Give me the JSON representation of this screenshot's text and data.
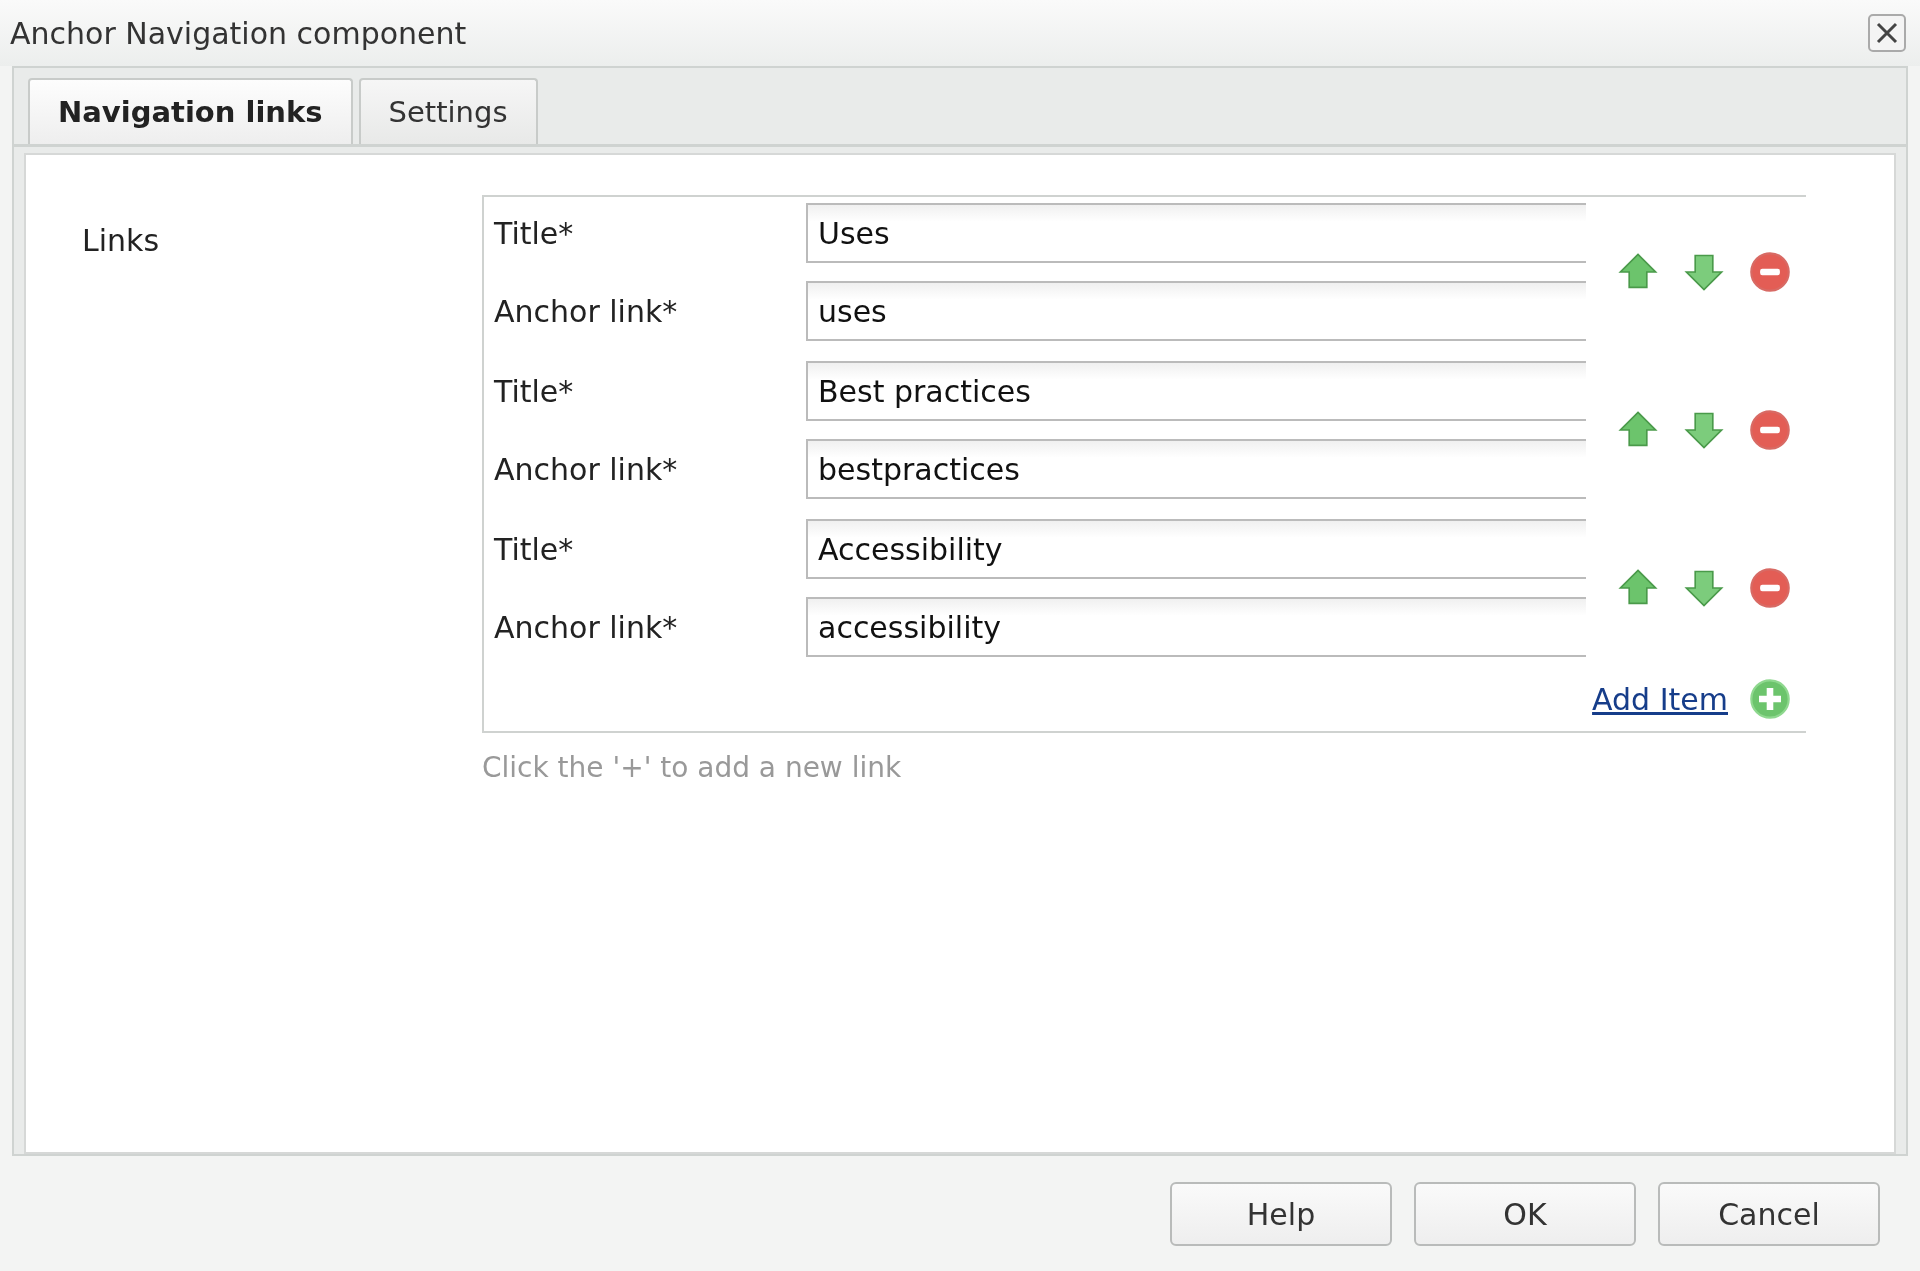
{
  "window": {
    "title": "Anchor Navigation component"
  },
  "tabs": [
    {
      "label": "Navigation links",
      "selected": true
    },
    {
      "label": "Settings",
      "selected": false
    }
  ],
  "field_label": "Links",
  "items": [
    {
      "title_label": "Title*",
      "title_value": "Uses",
      "anchor_label": "Anchor link*",
      "anchor_value": "uses"
    },
    {
      "title_label": "Title*",
      "title_value": "Best practices",
      "anchor_label": "Anchor link*",
      "anchor_value": "bestpractices"
    },
    {
      "title_label": "Title*",
      "title_value": "Accessibility",
      "anchor_label": "Anchor link*",
      "anchor_value": "accessibility"
    }
  ],
  "add_item": "Add Item",
  "hint": "Click the '+' to add a new link",
  "buttons": [
    "Help",
    "OK",
    "Cancel"
  ]
}
